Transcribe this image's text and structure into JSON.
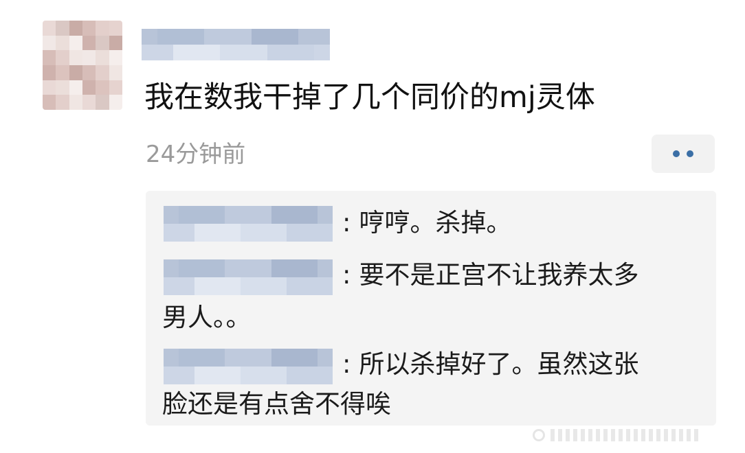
{
  "post": {
    "comment": "我在数我干掉了几个同价的mj灵体",
    "timestamp": "24分钟前",
    "more_icon": "more-dots-icon"
  },
  "replies": [
    {
      "separator": ":",
      "line1": "哼哼。杀掉。",
      "line2": ""
    },
    {
      "separator": ":",
      "line1": "要不是正宫不让我养太多",
      "line2": "男人。。"
    },
    {
      "separator": ":",
      "line1": "所以杀掉好了。虽然这张",
      "line2": "脸还是有点舍不得唉"
    }
  ],
  "colors": {
    "link_blue": "#3b6fa6",
    "muted_text": "#9a9a9a",
    "reply_bg": "#f4f4f4"
  }
}
